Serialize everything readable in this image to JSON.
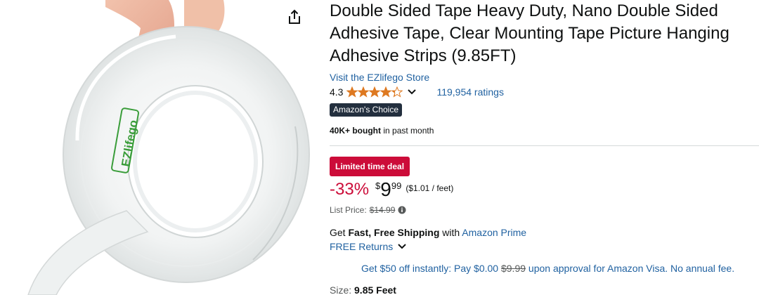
{
  "product": {
    "image_label": "EZlifego",
    "title": "Double Sided Tape Heavy Duty, Nano Double Sided Adhesive Tape, Clear Mounting Tape Picture Hanging Adhesive Strips (9.85FT)",
    "store_link": "Visit the EZlifego Store",
    "rating": "4.3",
    "rating_stars": 4.3,
    "ratings_count": "119,954 ratings",
    "badge": "Amazon's Choice",
    "bought_bold": "40K+ bought",
    "bought_rest": " in past month"
  },
  "deal": {
    "badge": "Limited time deal",
    "discount": "-33%",
    "price_symbol": "$",
    "price_whole": "9",
    "price_fraction": "99",
    "per_unit": "($1.01 / feet)",
    "list_price_label": "List Price:",
    "list_price": "$14.99"
  },
  "shipping": {
    "prefix": "Get ",
    "bold": "Fast, Free Shipping",
    "middle": " with ",
    "prime_link": "Amazon Prime",
    "returns": "FREE Returns"
  },
  "promo": {
    "text_a": "Get $50 off instantly: Pay $0.00 ",
    "struck": "$9.99",
    "text_b": " upon approval for Amazon Visa. No annual fee."
  },
  "size": {
    "label": "Size: ",
    "value": "9.85 Feet"
  },
  "colors": {
    "link": "#2162a1",
    "deal_red": "#cc0c39",
    "star": "#de7921",
    "badge_dark": "#232f3e"
  },
  "icons": {
    "share": "share-icon",
    "chevron": "chevron-down-icon",
    "info": "info-icon"
  }
}
